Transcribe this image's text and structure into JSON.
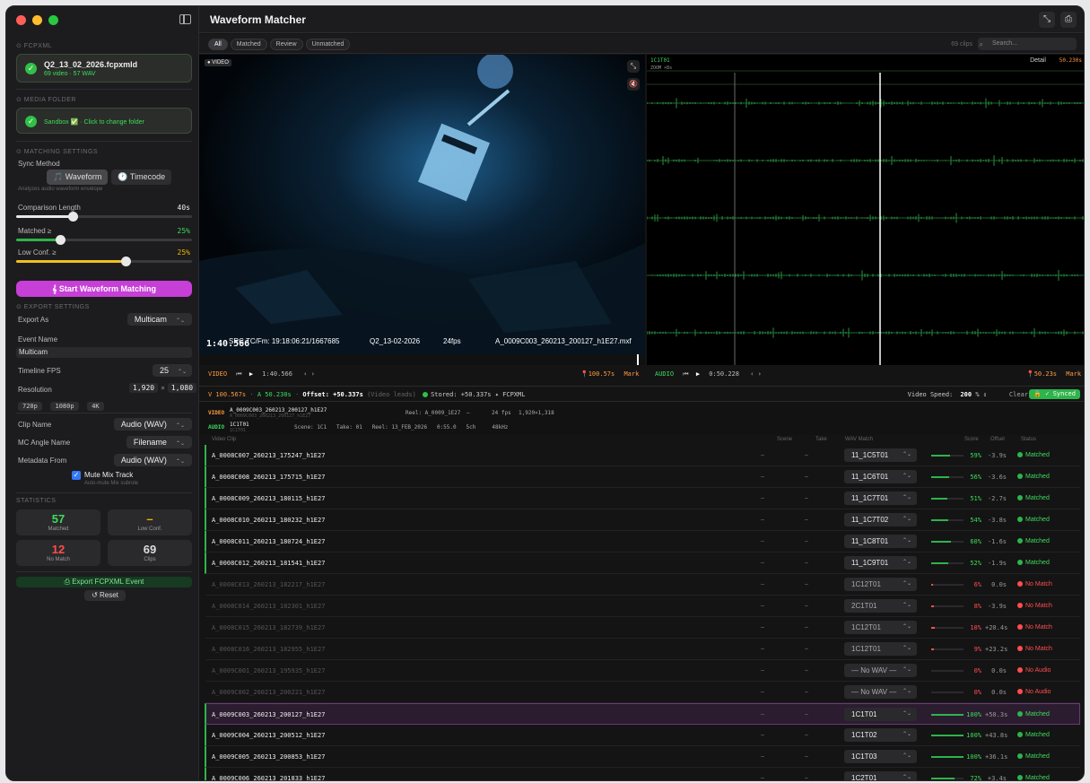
{
  "app": {
    "title": "Waveform Matcher"
  },
  "sidebar": {
    "fcpxml_header": "⊙ FCPXML",
    "fcpxml_file": "Q2_13_02_2026.fcpxmld",
    "fcpxml_sub": "69 video · 57 WAV",
    "media_header": "⊙ Media Folder",
    "media_text": "Sandbox ✅ · Click to change folder",
    "matching_header": "⊙ Matching Settings",
    "sync_method_label": "Sync Method",
    "sync_options": [
      "🎵 Waveform",
      "🕐 Timecode"
    ],
    "sync_hint": "Analyzes audio waveform envelope",
    "comparison_label": "Comparison Length",
    "comparison_value": "40s",
    "comparison_fraction": 0.32,
    "matched_label": "Matched ≥",
    "matched_value": "25%",
    "matched_fraction": 0.25,
    "lowconf_label": "Low Conf. ≥",
    "lowconf_value": "25%",
    "lowconf_fraction": 0.62,
    "start_button": "𝄞 Start Waveform Matching",
    "export_header": "⊙ Export Settings",
    "export_as_label": "Export As",
    "export_as_value": "Multicam",
    "event_name_label": "Event Name",
    "event_name_value": "Multicam",
    "fps_label": "Timeline FPS",
    "fps_value": "25",
    "resolution_label": "Resolution",
    "res_w": "1,920",
    "res_x": "×",
    "res_h": "1,080",
    "res_presets": [
      "720p",
      "1080p",
      "4K"
    ],
    "clip_name_label": "Clip Name",
    "clip_name_value": "Audio (WAV)",
    "mc_angle_label": "MC Angle Name",
    "mc_angle_value": "Filename",
    "metadata_label": "Metadata From",
    "metadata_value": "Audio (WAV)",
    "mute_label": "Mute Mix Track",
    "mute_hint": "Auto-mute Mix subrole",
    "stats_header": "Statistics",
    "stats": [
      {
        "value": "57",
        "label": "Matched",
        "color": "#3ddc5a"
      },
      {
        "value": "–",
        "label": "Low Conf.",
        "color": "#f0b800"
      },
      {
        "value": "12",
        "label": "No Match",
        "color": "#ff4d4d"
      },
      {
        "value": "69",
        "label": "Clips",
        "color": "#dddddd"
      }
    ],
    "export_button": "⎙ Export FCPXML Event",
    "reset_button": "↺ Reset"
  },
  "filters": [
    "All",
    "Matched",
    "Review",
    "Unmatched"
  ],
  "clip_count": "69 clips",
  "search_placeholder": "Search...",
  "video": {
    "badge": "● VIDEO",
    "timecode": "1:40.566",
    "tc_line": "SRC TC/Fm: 19:18:06:21/1667685",
    "date": "Q2_13-02-2026",
    "fps": "24fps",
    "file": "A_0009C003_260213_200127_h1E27.mxf",
    "ctrl_label": "VIDEO",
    "ctrl_time": "1:40.566",
    "mark_time": "100.57s",
    "mark_label": "Mark"
  },
  "audio": {
    "clip": "1C1T01",
    "zoom": "ZOOM ×8s",
    "detail": "Detail",
    "detail_time": "50.230s",
    "ctrl_label": "AUDIO",
    "ctrl_time": "0:50.228",
    "mark_time": "50.23s",
    "mark_label": "Mark"
  },
  "offset": {
    "v": "V 100.567s",
    "a": "A 50.230s",
    "offset": "Offset: +50.337s",
    "note": "(Video leads)",
    "stored": "Stored: +50.337s ✦ FCPXML",
    "speed_label": "Video Speed:",
    "speed_value": "200",
    "speed_unit": "%",
    "clear": "Clear",
    "synced": "🔒 ✓ Synced"
  },
  "info": {
    "video_tag": "VIDEO",
    "video_name": "A_0009C003_260213_200127_h1E27",
    "video_sub": "A_0009C003_260213_200127_h1E27",
    "video_reel": "Reel: A_0009_1E27",
    "video_dash": "–",
    "video_fps": "24 fps",
    "video_res": "1,920×1,318",
    "audio_tag": "AUDIO",
    "audio_name": "1C1T01",
    "audio_sub": "1C1T01",
    "audio_meta": "Scene: 1C1   Take: 01   Reel: 13_FEB_2026   0:55.0   5ch     48kHz"
  },
  "table": {
    "headers": [
      "Video Clip",
      "Scene",
      "Take",
      "WAV Match",
      "Score",
      "Offset",
      "Status"
    ],
    "rows": [
      {
        "name": "A_0008C007_260213_175247_h1E27",
        "scene": "–",
        "take": "–",
        "wav": "11_1C5T01",
        "score": 59,
        "pct": "59%",
        "offset": "-3.9s",
        "status": "Matched",
        "dim": false,
        "sel": false
      },
      {
        "name": "A_0008C008_260213_175715_h1E27",
        "scene": "–",
        "take": "–",
        "wav": "11_1C6T01",
        "score": 56,
        "pct": "56%",
        "offset": "-3.6s",
        "status": "Matched",
        "dim": false,
        "sel": false
      },
      {
        "name": "A_0008C009_260213_180115_h1E27",
        "scene": "–",
        "take": "–",
        "wav": "11_1C7T01",
        "score": 51,
        "pct": "51%",
        "offset": "-2.7s",
        "status": "Matched",
        "dim": false,
        "sel": false
      },
      {
        "name": "A_0008C010_260213_180232_h1E27",
        "scene": "–",
        "take": "–",
        "wav": "11_1C7T02",
        "score": 54,
        "pct": "54%",
        "offset": "-3.8s",
        "status": "Matched",
        "dim": false,
        "sel": false
      },
      {
        "name": "A_0008C011_260213_180724_h1E27",
        "scene": "–",
        "take": "–",
        "wav": "11_1C8T01",
        "score": 60,
        "pct": "60%",
        "offset": "-1.6s",
        "status": "Matched",
        "dim": false,
        "sel": false
      },
      {
        "name": "A_0008C012_260213_181541_h1E27",
        "scene": "–",
        "take": "–",
        "wav": "11_1C9T01",
        "score": 52,
        "pct": "52%",
        "offset": "-1.9s",
        "status": "Matched",
        "dim": false,
        "sel": false
      },
      {
        "name": "A_0008C013_260213_182217_h1E27",
        "scene": "–",
        "take": "–",
        "wav": "1C12T01",
        "score": 6,
        "pct": "6%",
        "offset": "0.0s",
        "status": "No Match",
        "dim": true,
        "sel": false
      },
      {
        "name": "A_0008C014_260213_182301_h1E27",
        "scene": "–",
        "take": "–",
        "wav": "2C1T01",
        "score": 8,
        "pct": "8%",
        "offset": "-3.9s",
        "status": "No Match",
        "dim": true,
        "sel": false
      },
      {
        "name": "A_0008C015_260213_182739_h1E27",
        "scene": "–",
        "take": "–",
        "wav": "1C12T01",
        "score": 10,
        "pct": "10%",
        "offset": "+20.4s",
        "status": "No Match",
        "dim": true,
        "sel": false
      },
      {
        "name": "A_0008C016_260213_182955_h1E27",
        "scene": "–",
        "take": "–",
        "wav": "1C12T01",
        "score": 9,
        "pct": "9%",
        "offset": "+23.2s",
        "status": "No Match",
        "dim": true,
        "sel": false
      },
      {
        "name": "A_0009C001_260213_195935_h1E27",
        "scene": "–",
        "take": "–",
        "wav": "— No WAV —",
        "score": 0,
        "pct": "0%",
        "offset": "0.0s",
        "status": "No Audio",
        "dim": true,
        "sel": false
      },
      {
        "name": "A_0009C002_260213_200221_h1E27",
        "scene": "–",
        "take": "–",
        "wav": "— No WAV —",
        "score": 0,
        "pct": "0%",
        "offset": "0.0s",
        "status": "No Audio",
        "dim": true,
        "sel": false
      },
      {
        "name": "A_0009C003_260213_200127_h1E27",
        "scene": "–",
        "take": "–",
        "wav": "1C1T01",
        "score": 100,
        "pct": "100%",
        "offset": "+50.3s",
        "status": "Matched",
        "dim": false,
        "sel": true
      },
      {
        "name": "A_0009C004_260213_200512_h1E27",
        "scene": "–",
        "take": "–",
        "wav": "1C1T02",
        "score": 100,
        "pct": "100%",
        "offset": "+43.8s",
        "status": "Matched",
        "dim": false,
        "sel": false
      },
      {
        "name": "A_0009C005_260213_200853_h1E27",
        "scene": "–",
        "take": "–",
        "wav": "1C1T03",
        "score": 100,
        "pct": "100%",
        "offset": "+36.1s",
        "status": "Matched",
        "dim": false,
        "sel": false
      },
      {
        "name": "A_0009C006_260213_201833_h1E27",
        "scene": "–",
        "take": "–",
        "wav": "1C2T01",
        "score": 72,
        "pct": "72%",
        "offset": "+3.4s",
        "status": "Matched",
        "dim": false,
        "sel": false
      }
    ]
  },
  "colors": {
    "accent": "#c63fd6",
    "green": "#2db44a",
    "orange": "#ff9a3c",
    "red": "#ff4d4d"
  }
}
